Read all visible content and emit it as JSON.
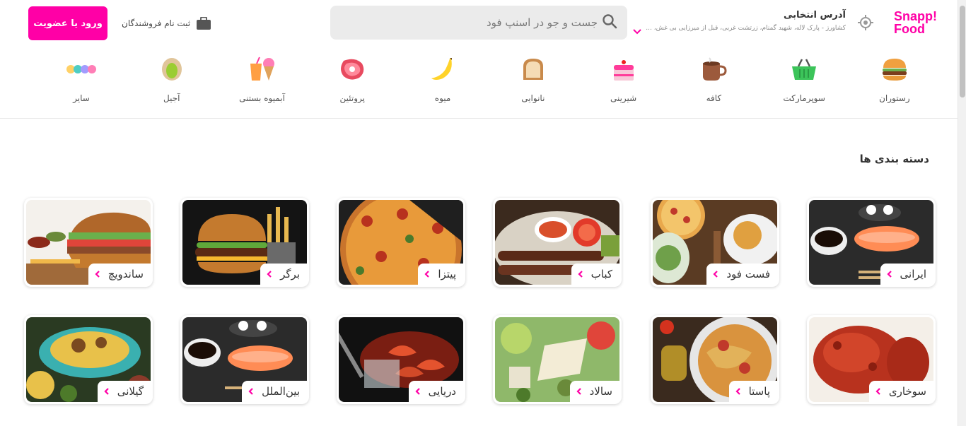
{
  "brand": {
    "logo_line1": "Snapp!",
    "logo_line2": "Food",
    "accent": "#ff00a6"
  },
  "header": {
    "address_title": "آدرس انتخابی",
    "address_detail": "کشاورز - پارک لاله، شهید گمنام، زرتشت غربی، قبل از میرزایی بی غش، ...",
    "search_placeholder": "جست و جو در اسنپ فود",
    "vendor_label": "ثبت نام فروشندگان",
    "login_label": "ورود یا عضویت"
  },
  "nav": [
    {
      "label": "رستوران",
      "icon": "burger-icon"
    },
    {
      "label": "سوپرمارکت",
      "icon": "basket-icon"
    },
    {
      "label": "کافه",
      "icon": "coffee-cup-icon"
    },
    {
      "label": "شیرینی",
      "icon": "cake-icon"
    },
    {
      "label": "نانوایی",
      "icon": "bread-icon"
    },
    {
      "label": "میوه",
      "icon": "banana-icon"
    },
    {
      "label": "پروتئین",
      "icon": "meat-icon"
    },
    {
      "label": "آبمیوه بستنی",
      "icon": "juice-icecream-icon"
    },
    {
      "label": "آجیل",
      "icon": "pistachio-icon"
    },
    {
      "label": "سایر",
      "icon": "more-dots-icon"
    }
  ],
  "section_title": "دسته بندی ها",
  "categories": [
    {
      "label": "ایرانی"
    },
    {
      "label": "فست فود"
    },
    {
      "label": "کباب"
    },
    {
      "label": "پیتزا"
    },
    {
      "label": "برگر"
    },
    {
      "label": "ساندویچ"
    },
    {
      "label": "سوخاری"
    },
    {
      "label": "پاستا"
    },
    {
      "label": "سالاد"
    },
    {
      "label": "دریایی"
    },
    {
      "label": "بین‌الملل"
    },
    {
      "label": "گیلانی"
    }
  ]
}
